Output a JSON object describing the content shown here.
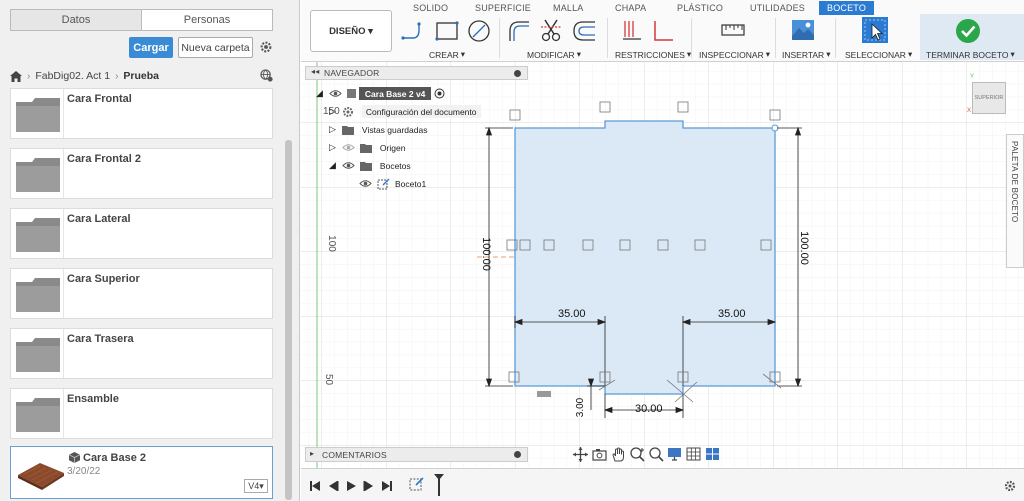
{
  "left_panel": {
    "tabs": [
      "Datos",
      "Personas"
    ],
    "upload_label": "Cargar",
    "new_folder_label": "Nueva carpeta",
    "breadcrumb": [
      "FabDig02. Act 1",
      "Prueba"
    ],
    "files": [
      {
        "name": "Cara Frontal"
      },
      {
        "name": "Cara Frontal 2"
      },
      {
        "name": "Cara Lateral"
      },
      {
        "name": "Cara Superior"
      },
      {
        "name": "Cara Trasera"
      },
      {
        "name": "Ensamble"
      }
    ],
    "model": {
      "name": "Cara Base 2",
      "date": "3/20/22",
      "version": "V4"
    }
  },
  "toolbar": {
    "tabs": [
      "SOLIDO",
      "SUPERFICIE",
      "MALLA",
      "CHAPA",
      "PLÁSTICO",
      "UTILIDADES",
      "BOCETO"
    ],
    "active_tab": "BOCETO",
    "design_label": "DISEÑO",
    "groups": [
      "CREAR",
      "MODIFICAR",
      "RESTRICCIONES",
      "INSPECCIONAR",
      "INSERTAR",
      "SELECCIONAR",
      "TERMINAR BOCETO"
    ],
    "accent": "#2a7bd1"
  },
  "browser": {
    "header": "NAVEGADOR",
    "root": "Cara Base 2 v4",
    "items": [
      "Configuración del documento",
      "Vistas guardadas",
      "Origen",
      "Bocetos",
      "Boceto1"
    ]
  },
  "canvas": {
    "axis_labels": [
      "150",
      "100",
      "50"
    ],
    "dimensions": {
      "left_height": "100.00",
      "right_height": "100.00",
      "left_width": "35.00",
      "right_width": "35.00",
      "notch_width": "30.00",
      "notch_depth": "3.00"
    },
    "palette_label": "PALETA DE BOCETO",
    "viewcube_label": "SUPERIOR",
    "profile_fill": "#dbe9f6",
    "profile_stroke": "#5b9bd5"
  },
  "comments_label": "COMENTARIOS"
}
